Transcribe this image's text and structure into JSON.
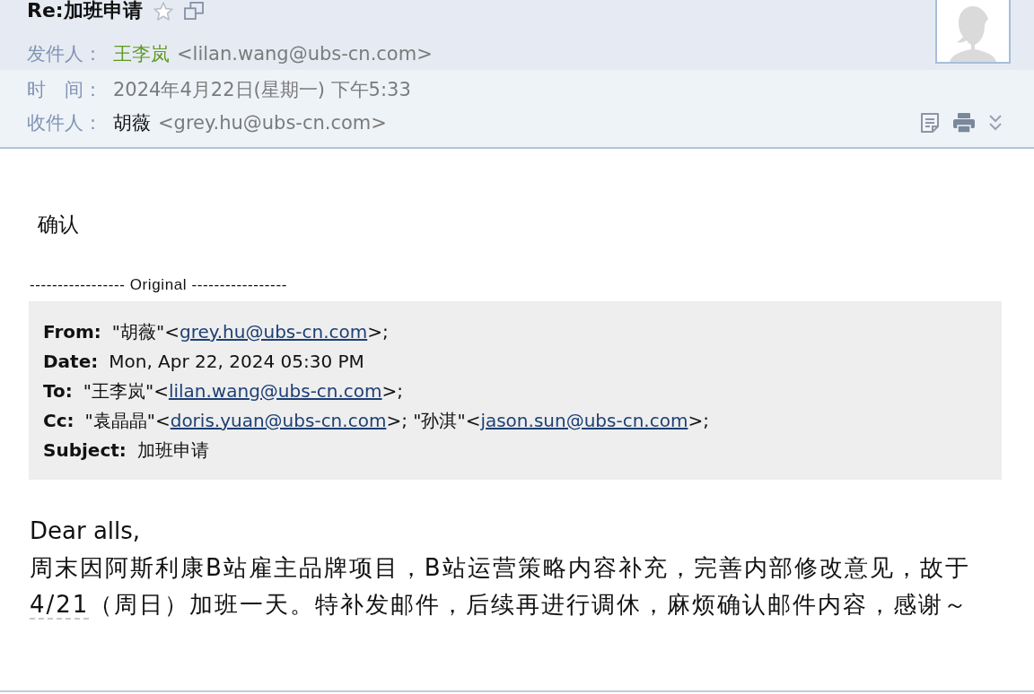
{
  "message": {
    "subject": "Re:加班申请",
    "starred": false,
    "header_fields": [
      {
        "kind": "sender",
        "label": "发件人：",
        "name": "王李岚",
        "address": "<lilan.wang@ubs-cn.com>"
      },
      {
        "kind": "time",
        "label": "时　间：",
        "value": "2024年4月22日(星期一) 下午5:33"
      },
      {
        "kind": "recipient",
        "label": "收件人：",
        "name": "胡薇",
        "address": "<grey.hu@ubs-cn.com>"
      }
    ]
  },
  "body": {
    "reply_text": "确认",
    "separator": "----------------- Original -----------------",
    "quoted_header": [
      {
        "label": "From:",
        "segments": [
          {
            "kind": "text",
            "text": "\"胡薇\"<"
          },
          {
            "kind": "link",
            "text": "grey.hu@ubs-cn.com"
          },
          {
            "kind": "text",
            "text": ">;"
          }
        ]
      },
      {
        "label": "Date:",
        "segments": [
          {
            "kind": "text",
            "text": "Mon, Apr 22, 2024 05:30 PM"
          }
        ]
      },
      {
        "label": "To:",
        "segments": [
          {
            "kind": "text",
            "text": "\"王李岚\"<"
          },
          {
            "kind": "link",
            "text": "lilan.wang@ubs-cn.com"
          },
          {
            "kind": "text",
            "text": ">;"
          }
        ]
      },
      {
        "label": "Cc:",
        "segments": [
          {
            "kind": "text",
            "text": "\"袁晶晶\"<"
          },
          {
            "kind": "link",
            "text": "doris.yuan@ubs-cn.com"
          },
          {
            "kind": "text",
            "text": ">; \"孙淇\"<"
          },
          {
            "kind": "link",
            "text": "jason.sun@ubs-cn.com"
          },
          {
            "kind": "text",
            "text": ">;"
          }
        ]
      },
      {
        "label": "Subject:",
        "segments": [
          {
            "kind": "text",
            "text": "加班申请"
          }
        ]
      }
    ],
    "greeting": "Dear alls,",
    "paragraph": [
      {
        "kind": "text",
        "text": "周末因阿斯利康B站雇主品牌项目，B站运营策略内容补充，完善内部修改意见，故于"
      },
      {
        "kind": "date",
        "text": "4/21"
      },
      {
        "kind": "text",
        "text": "（周日）加班一天。特补发邮件，后续再进行调休，麻烦确认邮件内容，感谢～"
      }
    ]
  }
}
